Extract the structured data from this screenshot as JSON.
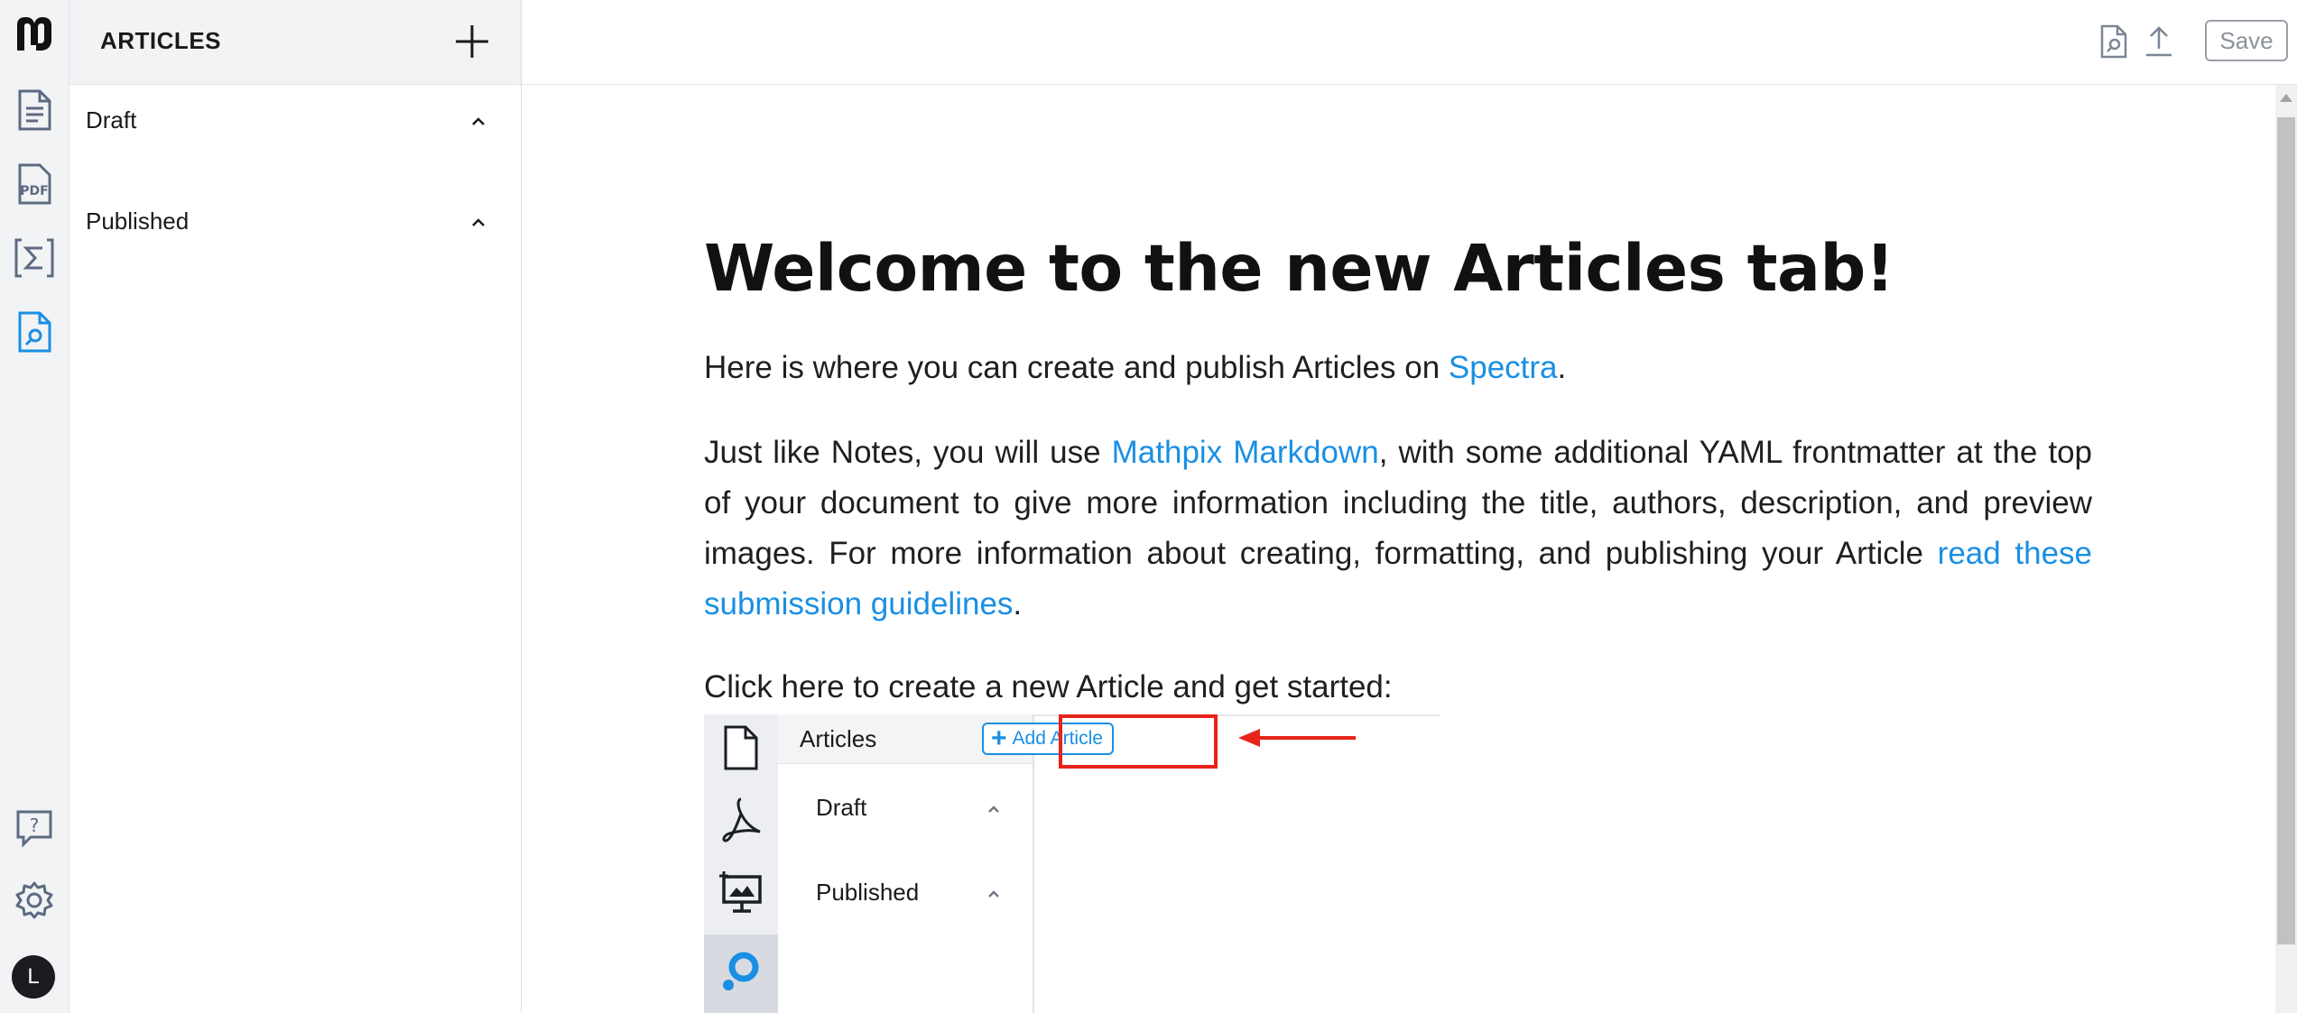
{
  "colors": {
    "accent": "#1a8fe3",
    "highlight": "#e8231b",
    "rail_bg": "#f2f3f5",
    "text": "#1a1a1a"
  },
  "rail": {
    "icons": [
      "mathpix-logo-icon",
      "document-icon",
      "pdf-icon",
      "sigma-icon",
      "article-icon",
      "help-icon",
      "gear-icon"
    ],
    "avatar_initial": "L"
  },
  "sidebar": {
    "title": "ARTICLES",
    "sections": [
      {
        "label": "Draft"
      },
      {
        "label": "Published"
      }
    ]
  },
  "topbar": {
    "icons": [
      "article-preview-icon",
      "upload-icon"
    ],
    "save_label": "Save"
  },
  "content": {
    "title": "Welcome to the new Articles tab!",
    "p1": {
      "before": "Here is where you can create and publish Articles on ",
      "link": "Spectra",
      "after": "."
    },
    "p2": {
      "before": "Just like Notes, you will use ",
      "link1": "Mathpix Markdown",
      "middle": ", with some additional YAML frontmatter at the top of your document to give more information including the title, authors, description, and preview images. For more information about creating, formatting, and publishing your Article ",
      "link2": "read these submission guidelines",
      "after": "."
    },
    "p3": "Click here to create a new Article and get started:"
  },
  "illustration": {
    "header_label": "Articles",
    "add_button_label": "Add Article",
    "sections": [
      {
        "label": "Draft"
      },
      {
        "label": "Published"
      }
    ]
  }
}
